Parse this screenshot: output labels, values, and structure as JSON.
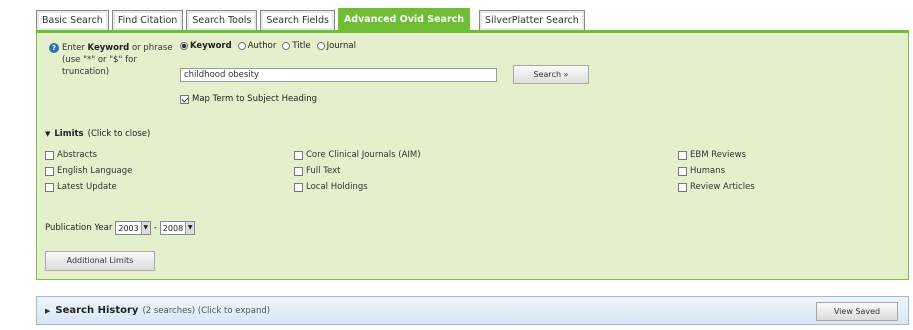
{
  "tabs": [
    {
      "label": "Basic Search",
      "active": false
    },
    {
      "label": "Find Citation",
      "active": false
    },
    {
      "label": "Search Tools",
      "active": false
    },
    {
      "label": "Search Fields",
      "active": false
    },
    {
      "label": "Advanced Ovid Search",
      "active": true
    },
    {
      "label": "SilverPlatter Search",
      "active": false
    }
  ],
  "search": {
    "prompt_pre": "Enter ",
    "prompt_keyword": "Keyword",
    "prompt_post": " or phrase (use \"*\" or \"$\" for truncation)",
    "modes": [
      {
        "label": "Keyword",
        "selected": true
      },
      {
        "label": "Author",
        "selected": false
      },
      {
        "label": "Title",
        "selected": false
      },
      {
        "label": "Journal",
        "selected": false
      }
    ],
    "query_value": "childhood obesity",
    "search_button": "Search »",
    "map_term_label": "Map Term to Subject Heading",
    "map_term_checked": true
  },
  "limits": {
    "title": "Limits",
    "toggle_hint": "(Click to close)",
    "col1": [
      {
        "label": "Abstracts",
        "checked": false
      },
      {
        "label": "English Language",
        "checked": false
      },
      {
        "label": "Latest Update",
        "checked": false
      }
    ],
    "col2": [
      {
        "label": "Core Clinical Journals (AIM)",
        "checked": false
      },
      {
        "label": "Full Text",
        "checked": false
      },
      {
        "label": "Local Holdings",
        "checked": false
      }
    ],
    "col3": [
      {
        "label": "EBM Reviews",
        "checked": false
      },
      {
        "label": "Humans",
        "checked": false
      },
      {
        "label": "Review Articles",
        "checked": false
      }
    ],
    "publication_year_label": "Publication Year",
    "year_from": "2003",
    "year_separator": "-",
    "year_to": "2008",
    "additional_limits_button": "Additional Limits"
  },
  "history": {
    "title": "Search History",
    "subtitle": "(2 searches) (Click to expand)",
    "view_saved_button": "View Saved"
  }
}
